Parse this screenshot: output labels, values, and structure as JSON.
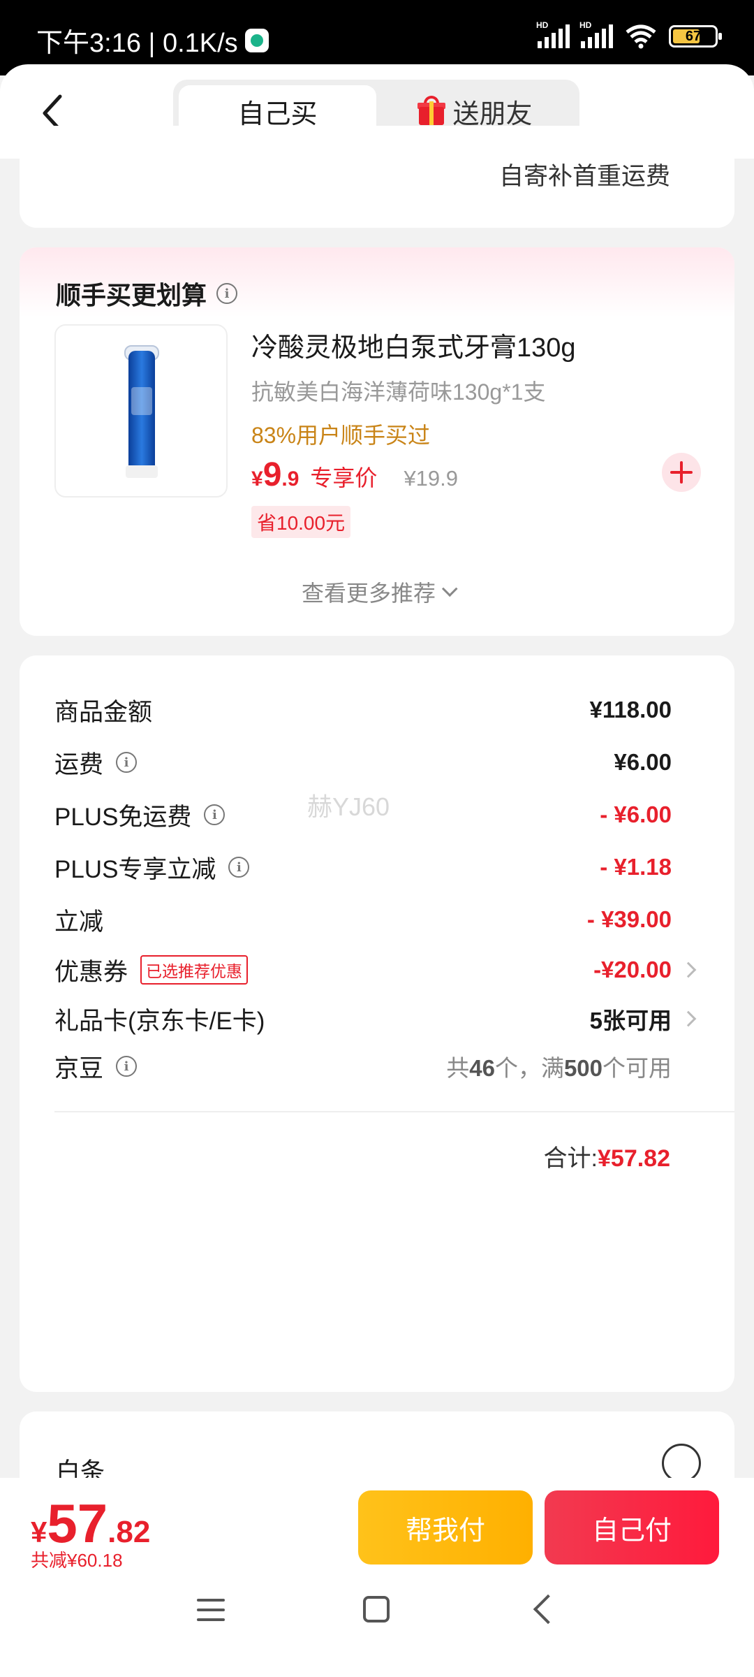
{
  "status_bar": {
    "time": "下午3:16 | 0.1K/s",
    "battery": "67",
    "hd1": "HD",
    "hd2": "HD"
  },
  "header": {
    "tabs": [
      {
        "label": "自己买",
        "active": true
      },
      {
        "label": "送朋友",
        "active": false
      }
    ]
  },
  "shipping_note": "自寄补首重运费",
  "recommend": {
    "title": "顺手买更划算",
    "product": {
      "name": "冷酸灵极地白泵式牙膏130g",
      "spec": "抗敏美白海洋薄荷味130g*1支",
      "social": "83%用户顺手买过",
      "price_symbol": "¥",
      "price_int": "9",
      "price_dec": ".9",
      "price_tag": "专享价",
      "original_price": "¥19.9",
      "save": "省10.00元"
    },
    "more": "查看更多推荐"
  },
  "fees": {
    "rows": [
      {
        "label": "商品金额",
        "value": "¥118.00"
      },
      {
        "label": "运费",
        "value": "¥6.00"
      },
      {
        "label": "PLUS免运费",
        "value": "- ¥6.00"
      },
      {
        "label": "PLUS专享立减",
        "value": "- ¥1.18"
      },
      {
        "label": "立减",
        "value": "- ¥39.00"
      },
      {
        "label": "优惠券",
        "tag": "已选推荐优惠",
        "value": "-¥20.00"
      },
      {
        "label": "礼品卡(京东卡/E卡)",
        "value": "5张可用"
      },
      {
        "label": "京豆",
        "value_prefix": "共",
        "value_count": "46",
        "value_mid": "个，满",
        "value_count2": "500",
        "value_suffix": "个可用"
      }
    ],
    "total_label": "合计:",
    "total_value": "¥57.82"
  },
  "watermark": "赫YJ60",
  "payment": {
    "method": "白条"
  },
  "bottom": {
    "price_symbol": "¥",
    "price_int": "57",
    "price_dec": ".82",
    "saved": "共减¥60.18",
    "help_pay": "帮我付",
    "self_pay": "自己付"
  },
  "colors": {
    "accent_red": "#e8202c",
    "help_yellow": "#ffb000",
    "social_orange": "#c98417"
  }
}
